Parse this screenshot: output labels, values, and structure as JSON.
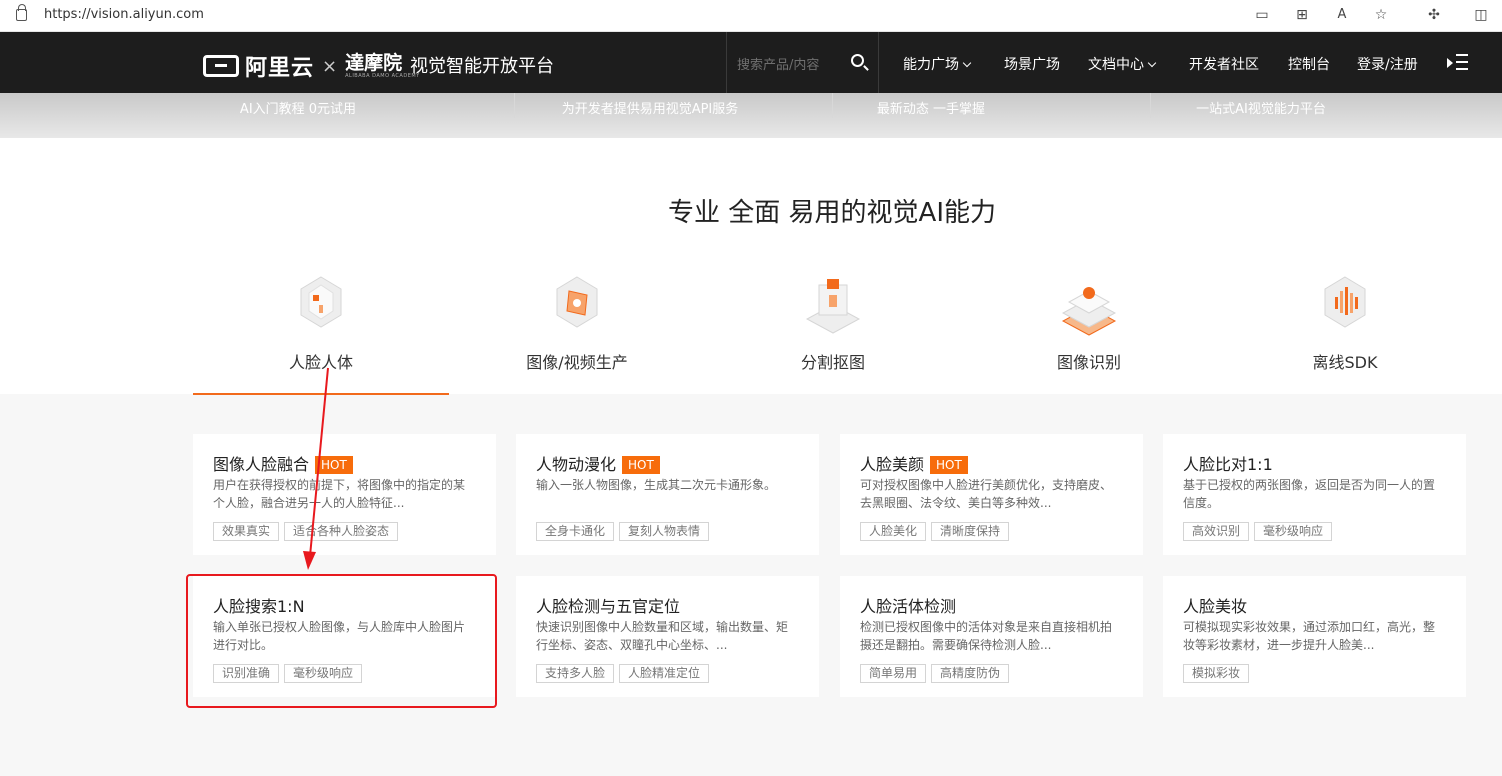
{
  "browser": {
    "url": "https://vision.aliyun.com"
  },
  "header": {
    "brand": "阿里云",
    "times": "×",
    "damo": "達摩院",
    "damo_sub": "ALIBABA DAMO ACADEMY",
    "platform": "视觉智能开放平台",
    "search_placeholder": "搜索产品/内容",
    "menu": [
      {
        "label": "能力广场",
        "dropdown": true
      },
      {
        "label": "场景广场",
        "dropdown": false
      },
      {
        "label": "文档中心",
        "dropdown": true
      },
      {
        "label": "开发者社区",
        "dropdown": false
      },
      {
        "label": "控制台",
        "dropdown": false
      },
      {
        "label": "登录/注册",
        "dropdown": false
      }
    ]
  },
  "banner": [
    "AI入门教程 0元试用",
    "为开发者提供易用视觉API服务",
    "最新动态 一手掌握",
    "一站式AI视觉能力平台"
  ],
  "section_title": "专业 全面 易用的视觉AI能力",
  "tabs": [
    {
      "label": "人脸人体",
      "active": true,
      "icon": "face-body-icon"
    },
    {
      "label": "图像/视频生产",
      "active": false,
      "icon": "image-video-icon"
    },
    {
      "label": "分割抠图",
      "active": false,
      "icon": "segmentation-icon"
    },
    {
      "label": "图像识别",
      "active": false,
      "icon": "image-recognition-icon"
    },
    {
      "label": "离线SDK",
      "active": false,
      "icon": "offline-sdk-icon"
    }
  ],
  "cards": [
    {
      "title": "图像人脸融合",
      "hot": "HOT",
      "desc": "用户在获得授权的前提下，将图像中的指定的某个人脸，融合进另一人的人脸特征...",
      "tags": [
        "效果真实",
        "适合各种人脸姿态"
      ]
    },
    {
      "title": "人物动漫化",
      "hot": "HOT",
      "desc": "输入一张人物图像，生成其二次元卡通形象。",
      "tags": [
        "全身卡通化",
        "复刻人物表情"
      ]
    },
    {
      "title": "人脸美颜",
      "hot": "HOT",
      "desc": "可对授权图像中人脸进行美颜优化，支持磨皮、去黑眼圈、法令纹、美白等多种效...",
      "tags": [
        "人脸美化",
        "清晰度保持"
      ]
    },
    {
      "title": "人脸比对1:1",
      "hot": "",
      "desc": "基于已授权的两张图像，返回是否为同一人的置信度。",
      "tags": [
        "高效识别",
        "毫秒级响应"
      ]
    },
    {
      "title": "人脸搜索1:N",
      "hot": "",
      "desc": "输入单张已授权人脸图像，与人脸库中人脸图片进行对比。",
      "tags": [
        "识别准确",
        "毫秒级响应"
      ]
    },
    {
      "title": "人脸检测与五官定位",
      "hot": "",
      "desc": "快速识别图像中人脸数量和区域，输出数量、矩行坐标、姿态、双瞳孔中心坐标、...",
      "tags": [
        "支持多人脸",
        "人脸精准定位"
      ]
    },
    {
      "title": "人脸活体检测",
      "hot": "",
      "desc": "检测已授权图像中的活体对象是来自直接相机拍摄还是翻拍。需要确保待检测人脸...",
      "tags": [
        "简单易用",
        "高精度防伪"
      ]
    },
    {
      "title": "人脸美妆",
      "hot": "",
      "desc": "可模拟现实彩妆效果，通过添加口红，高光，整妆等彩妆素材，进一步提升人脸美...",
      "tags": [
        "模拟彩妆"
      ]
    }
  ],
  "colors": {
    "accent": "#f26a1c",
    "hot": "#f76c0b",
    "highlight": "#e8191e",
    "header_bg": "#1d1d1d"
  }
}
